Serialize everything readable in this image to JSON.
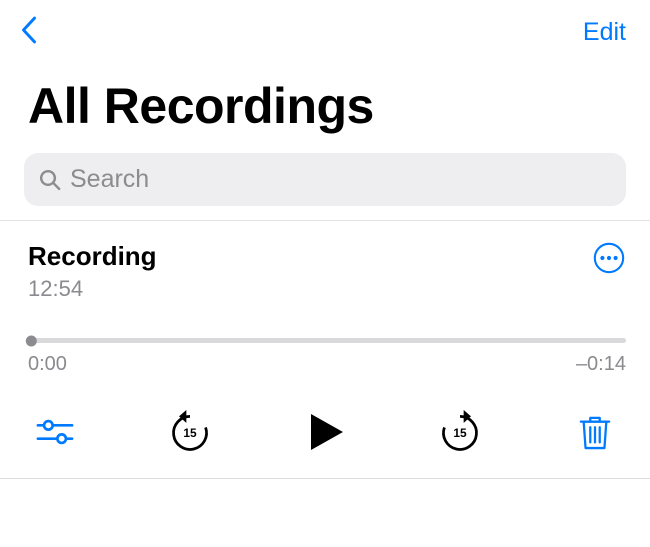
{
  "header": {
    "edit_label": "Edit",
    "title": "All Recordings"
  },
  "search": {
    "placeholder": "Search",
    "value": ""
  },
  "recording": {
    "name": "Recording",
    "timestamp": "12:54",
    "elapsed": "0:00",
    "remaining": "–0:14",
    "skip_seconds": "15"
  }
}
